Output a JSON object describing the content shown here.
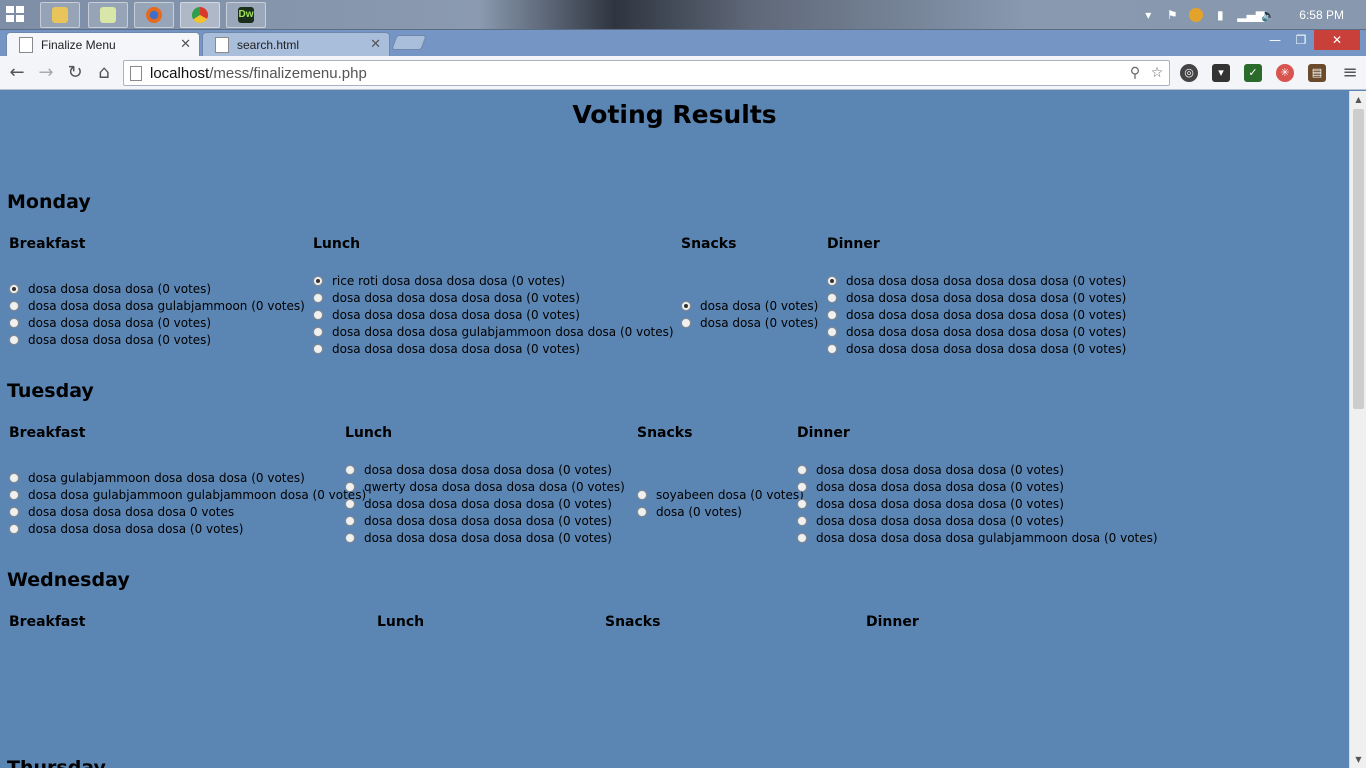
{
  "taskbar": {
    "apps": [
      {
        "name": "file-explorer",
        "label": ""
      },
      {
        "name": "sticky-notes",
        "label": ""
      },
      {
        "name": "firefox",
        "label": ""
      },
      {
        "name": "chrome",
        "label": ""
      },
      {
        "name": "dreamweaver",
        "label": "Dw"
      }
    ],
    "clock": "6:58 PM"
  },
  "browser": {
    "tabs": [
      {
        "title": "Finalize Menu",
        "active": true
      },
      {
        "title": "search.html",
        "active": false
      }
    ],
    "url_host": "localhost",
    "url_path": "/mess/finalizemenu.php"
  },
  "page": {
    "title": "Voting Results",
    "days": [
      {
        "name": "Monday",
        "meals": [
          {
            "label": "Breakfast",
            "options": [
              {
                "text": "dosa dosa dosa dosa (0 votes)",
                "checked": true
              },
              {
                "text": "dosa dosa dosa dosa gulabjammoon (0 votes)",
                "checked": false
              },
              {
                "text": "dosa dosa dosa dosa (0 votes)",
                "checked": false
              },
              {
                "text": "dosa dosa dosa dosa (0 votes)",
                "checked": false
              }
            ]
          },
          {
            "label": "Lunch",
            "options": [
              {
                "text": "rice roti dosa dosa dosa dosa (0 votes)",
                "checked": true
              },
              {
                "text": "dosa dosa dosa dosa dosa dosa (0 votes)",
                "checked": false
              },
              {
                "text": "dosa dosa dosa dosa dosa dosa (0 votes)",
                "checked": false
              },
              {
                "text": "dosa dosa dosa dosa gulabjammoon dosa dosa (0 votes)",
                "checked": false
              },
              {
                "text": "dosa dosa dosa dosa dosa dosa (0 votes)",
                "checked": false
              }
            ]
          },
          {
            "label": "Snacks",
            "options": [
              {
                "text": "dosa dosa (0 votes)",
                "checked": true
              },
              {
                "text": "dosa dosa (0 votes)",
                "checked": false
              }
            ]
          },
          {
            "label": "Dinner",
            "options": [
              {
                "text": "dosa dosa dosa dosa dosa dosa dosa (0 votes)",
                "checked": true
              },
              {
                "text": "dosa dosa dosa dosa dosa dosa dosa (0 votes)",
                "checked": false
              },
              {
                "text": "dosa dosa dosa dosa dosa dosa dosa (0 votes)",
                "checked": false
              },
              {
                "text": "dosa dosa dosa dosa dosa dosa dosa (0 votes)",
                "checked": false
              },
              {
                "text": "dosa dosa dosa dosa dosa dosa dosa (0 votes)",
                "checked": false
              }
            ]
          }
        ]
      },
      {
        "name": "Tuesday",
        "meals": [
          {
            "label": "Breakfast",
            "options": [
              {
                "text": "dosa gulabjammoon dosa dosa dosa (0 votes)",
                "checked": false
              },
              {
                "text": "dosa dosa gulabjammoon gulabjammoon dosa (0 votes)",
                "checked": false
              },
              {
                "text": "dosa dosa dosa dosa dosa 0 votes",
                "checked": false
              },
              {
                "text": "dosa dosa dosa dosa dosa (0 votes)",
                "checked": false
              }
            ]
          },
          {
            "label": "Lunch",
            "options": [
              {
                "text": "dosa dosa dosa dosa dosa dosa (0 votes)",
                "checked": false
              },
              {
                "text": "qwerty dosa dosa dosa dosa dosa (0 votes)",
                "checked": false
              },
              {
                "text": "dosa dosa dosa dosa dosa dosa (0 votes)",
                "checked": false
              },
              {
                "text": "dosa dosa dosa dosa dosa dosa (0 votes)",
                "checked": false
              },
              {
                "text": "dosa dosa dosa dosa dosa dosa (0 votes)",
                "checked": false
              }
            ]
          },
          {
            "label": "Snacks",
            "options": [
              {
                "text": "soyabeen dosa (0 votes)",
                "checked": false
              },
              {
                "text": "dosa (0 votes)",
                "checked": false
              }
            ]
          },
          {
            "label": "Dinner",
            "options": [
              {
                "text": "dosa dosa dosa dosa dosa dosa (0 votes)",
                "checked": false
              },
              {
                "text": "dosa dosa dosa dosa dosa dosa (0 votes)",
                "checked": false
              },
              {
                "text": "dosa dosa dosa dosa dosa dosa (0 votes)",
                "checked": false
              },
              {
                "text": "dosa dosa dosa dosa dosa dosa (0 votes)",
                "checked": false
              },
              {
                "text": "dosa dosa dosa dosa dosa gulabjammoon dosa (0 votes)",
                "checked": false
              }
            ]
          }
        ]
      },
      {
        "name": "Wednesday",
        "meals": [
          {
            "label": "Breakfast",
            "options": []
          },
          {
            "label": "Lunch",
            "options": []
          },
          {
            "label": "Snacks",
            "options": []
          },
          {
            "label": "Dinner",
            "options": []
          }
        ]
      },
      {
        "name": "Thursday",
        "meals": []
      }
    ]
  },
  "colors": {
    "page_bg": "#5b86b3",
    "tabstrip_bg": "#7596c4",
    "close_red": "#c9403a"
  }
}
